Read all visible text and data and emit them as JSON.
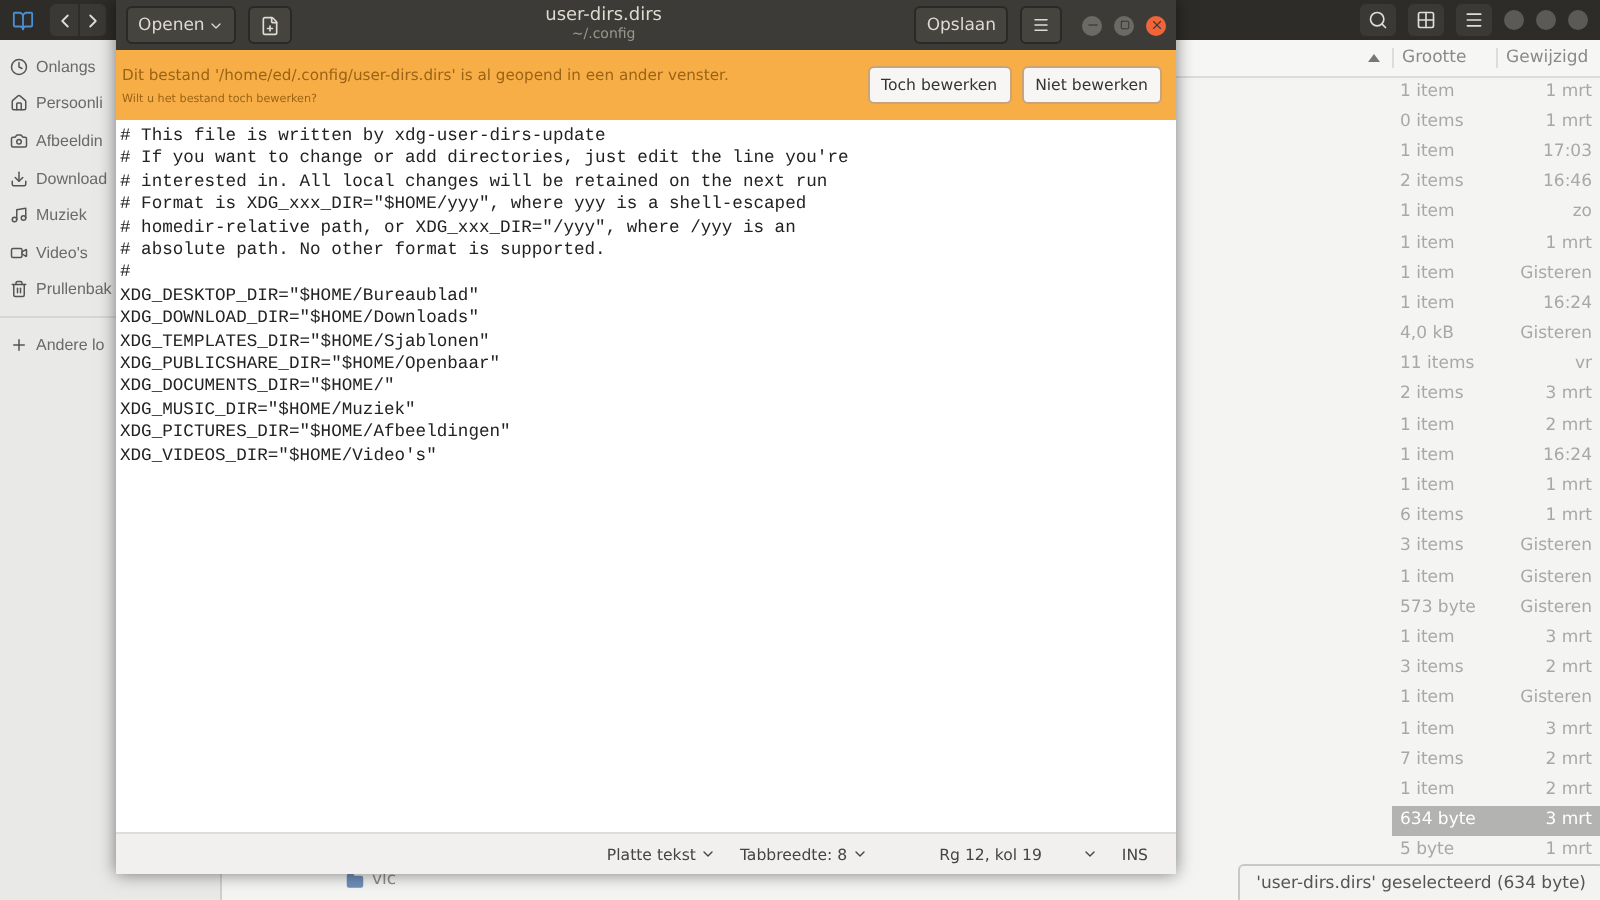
{
  "file_manager": {
    "sidebar": [
      {
        "label": "Onlangs"
      },
      {
        "label": "Persoonli"
      },
      {
        "label": "Afbeeldin"
      },
      {
        "label": "Download"
      },
      {
        "label": "Muziek"
      },
      {
        "label": "Video's"
      },
      {
        "label": "Prullenbak"
      },
      {
        "label": "Andere lo"
      }
    ],
    "columns": [
      {
        "label": "Grootte"
      },
      {
        "label": "Gewijzigd"
      }
    ],
    "rows": [
      {
        "size": "1 item",
        "modified": "1 mrt",
        "selected": false
      },
      {
        "size": "0 items",
        "modified": "1 mrt",
        "selected": false
      },
      {
        "size": "1 item",
        "modified": "17:03",
        "selected": false
      },
      {
        "size": "2 items",
        "modified": "16:46",
        "selected": false
      },
      {
        "size": "1 item",
        "modified": "zo",
        "selected": false
      },
      {
        "size": "1 item",
        "modified": "1 mrt",
        "selected": false
      },
      {
        "size": "1 item",
        "modified": "Gisteren",
        "selected": false
      },
      {
        "size": "1 item",
        "modified": "16:24",
        "selected": false
      },
      {
        "size": "4,0 kB",
        "modified": "Gisteren",
        "selected": false
      },
      {
        "size": "11 items",
        "modified": "vr",
        "selected": false
      },
      {
        "size": "2 items",
        "modified": "3 mrt",
        "selected": false
      },
      {
        "size": "1 item",
        "modified": "2 mrt",
        "selected": false
      },
      {
        "size": "1 item",
        "modified": "16:24",
        "selected": false
      },
      {
        "size": "1 item",
        "modified": "1 mrt",
        "selected": false
      },
      {
        "size": "6 items",
        "modified": "1 mrt",
        "selected": false
      },
      {
        "size": "3 items",
        "modified": "Gisteren",
        "selected": false
      },
      {
        "size": "1 item",
        "modified": "Gisteren",
        "selected": false
      },
      {
        "size": "573 byte",
        "modified": "Gisteren",
        "selected": false
      },
      {
        "size": "1 item",
        "modified": "3 mrt",
        "selected": false
      },
      {
        "size": "3 items",
        "modified": "2 mrt",
        "selected": false
      },
      {
        "size": "1 item",
        "modified": "Gisteren",
        "selected": false
      },
      {
        "size": "1 item",
        "modified": "3 mrt",
        "selected": false
      },
      {
        "size": "7 items",
        "modified": "2 mrt",
        "selected": false
      },
      {
        "size": "1 item",
        "modified": "2 mrt",
        "selected": false
      },
      {
        "size": "634 byte",
        "modified": "3 mrt",
        "selected": true
      },
      {
        "size": "5 byte",
        "modified": "1 mrt",
        "selected": false
      },
      {
        "name": "vlc",
        "selected": false
      }
    ],
    "status": "'user-dirs.dirs' geselecteerd (634 byte)"
  },
  "editor": {
    "open_button": "Openen",
    "title": "user-dirs.dirs",
    "subtitle": "~/.config",
    "save_button": "Opslaan",
    "infobar": {
      "message": "Dit bestand '/home/ed/.config/user-dirs.dirs' is al geopend in een ander venster.",
      "question": "Wilt u het bestand toch bewerken?",
      "buttons": [
        "Toch bewerken",
        "Niet bewerken"
      ]
    },
    "lines": [
      "# This file is written by xdg-user-dirs-update",
      "# If you want to change or add directories, just edit the line you're",
      "# interested in. All local changes will be retained on the next run",
      "# Format is XDG_xxx_DIR=\"$HOME/yyy\", where yyy is a shell-escaped",
      "# homedir-relative path, or XDG_xxx_DIR=\"/yyy\", where /yyy is an",
      "# absolute path. No other format is supported.",
      "#",
      "XDG_DESKTOP_DIR=\"$HOME/Bureaublad\"",
      "XDG_DOWNLOAD_DIR=\"$HOME/Downloads\"",
      "XDG_TEMPLATES_DIR=\"$HOME/Sjablonen\"",
      "XDG_PUBLICSHARE_DIR=\"$HOME/Openbaar\"",
      "XDG_DOCUMENTS_DIR=\"$HOME/\"",
      "XDG_MUSIC_DIR=\"$HOME/Muziek\"",
      "XDG_PICTURES_DIR=\"$HOME/Afbeeldingen\"",
      "XDG_VIDEOS_DIR=\"$HOME/Video's\""
    ],
    "status_bar": {
      "language": "Platte tekst",
      "tab_width": "Tabbreedte: 8",
      "position": "Rg 12, kol 19",
      "mode": "INS"
    }
  }
}
